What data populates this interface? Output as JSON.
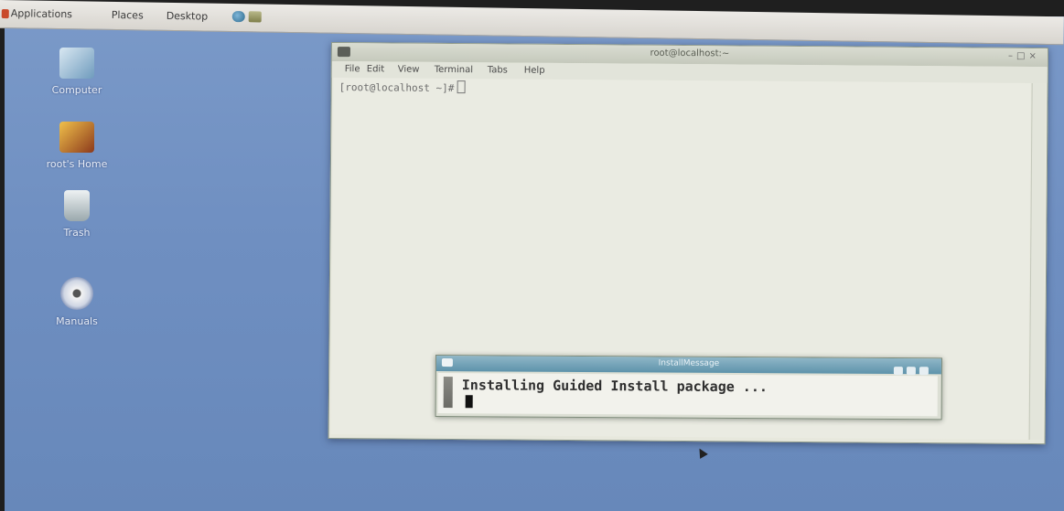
{
  "panel": {
    "menus": [
      "Applications",
      "Places",
      "Desktop"
    ],
    "launchers": [
      "web-browser-icon",
      "mail-icon"
    ]
  },
  "desktop": {
    "icons": [
      {
        "label": "Computer",
        "icon": "computer-icon"
      },
      {
        "label": "root's Home",
        "icon": "home-folder-icon"
      },
      {
        "label": "Trash",
        "icon": "trash-icon"
      },
      {
        "label": "Manuals",
        "icon": "disc-icon"
      }
    ]
  },
  "terminal": {
    "title": "root@localhost:~",
    "menus": [
      "File",
      "Edit",
      "View",
      "Terminal",
      "Tabs",
      "Help"
    ],
    "prompt": "[root@localhost ~]#"
  },
  "install_dialog": {
    "title": "InstallMessage",
    "message": "Installing Guided Install package ..."
  },
  "colors": {
    "desktop": "#6f8fc1",
    "dialog_titlebar": "#5e93ab"
  }
}
